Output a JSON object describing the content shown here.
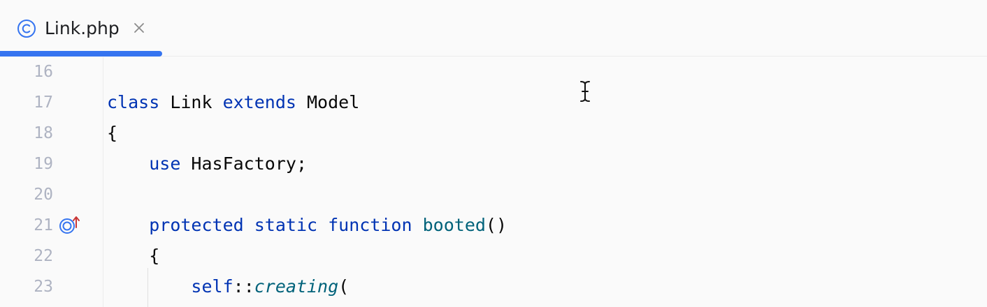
{
  "tabs": [
    {
      "label": "Link.php",
      "icon": "class-icon",
      "active": true
    }
  ],
  "lines": [
    {
      "number": "16",
      "tokens": []
    },
    {
      "number": "17",
      "tokens": [
        {
          "t": "class",
          "c": "kw"
        },
        {
          "t": " Link ",
          "c": ""
        },
        {
          "t": "extends",
          "c": "kw"
        },
        {
          "t": " Model",
          "c": ""
        }
      ]
    },
    {
      "number": "18",
      "tokens": [
        {
          "t": "{",
          "c": ""
        }
      ]
    },
    {
      "number": "19",
      "tokens": [
        {
          "t": "    ",
          "c": ""
        },
        {
          "t": "use",
          "c": "kw"
        },
        {
          "t": " HasFactory;",
          "c": ""
        }
      ]
    },
    {
      "number": "20",
      "tokens": []
    },
    {
      "number": "21",
      "marker": "override-method-icon",
      "tokens": [
        {
          "t": "    ",
          "c": ""
        },
        {
          "t": "protected",
          "c": "kw"
        },
        {
          "t": " ",
          "c": ""
        },
        {
          "t": "static",
          "c": "kw"
        },
        {
          "t": " ",
          "c": ""
        },
        {
          "t": "function",
          "c": "kw"
        },
        {
          "t": " ",
          "c": ""
        },
        {
          "t": "booted",
          "c": "fn"
        },
        {
          "t": "()",
          "c": ""
        }
      ]
    },
    {
      "number": "22",
      "tokens": [
        {
          "t": "    {",
          "c": ""
        }
      ]
    },
    {
      "number": "23",
      "tokens": [
        {
          "t": "        ",
          "c": ""
        },
        {
          "t": "self",
          "c": "kw"
        },
        {
          "t": "::",
          "c": ""
        },
        {
          "t": "creating",
          "c": "st"
        },
        {
          "t": "(",
          "c": ""
        }
      ]
    }
  ],
  "colors": {
    "keyword": "#0033b3",
    "function": "#00627a",
    "text": "#080808",
    "line_number": "#aeb3c2",
    "tab_underline": "#3574f0"
  }
}
